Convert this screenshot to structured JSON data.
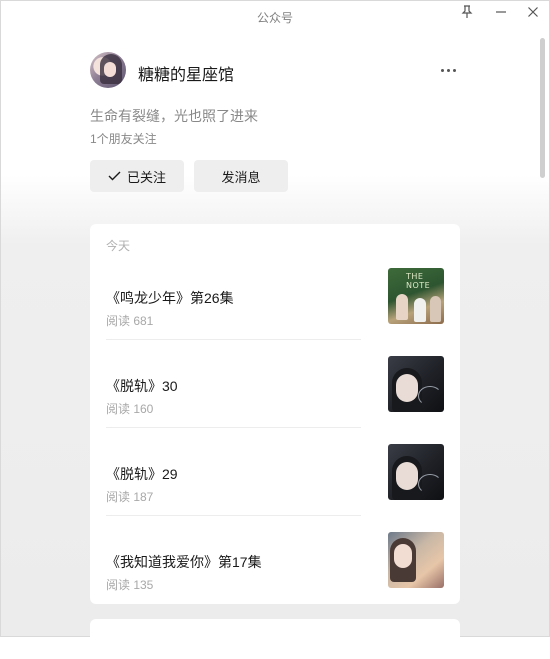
{
  "window": {
    "title": "公众号",
    "controls": {
      "pin_icon": "pin-icon",
      "minimize_icon": "minimize-icon",
      "close_icon": "close-icon"
    }
  },
  "account": {
    "name": "糖糖的星座馆",
    "bio": "生命有裂缝，光也照了进来",
    "followers_text": "1个朋友关注",
    "avatar_icon": "avatar",
    "more_icon": "more-dots-icon"
  },
  "actions": {
    "followed_label": "已关注",
    "followed_icon": "checkmark-icon",
    "message_label": "发消息"
  },
  "feed": {
    "section_label": "今天",
    "articles": [
      {
        "title": "《鸣龙少年》第26集",
        "reads": "阅读 681"
      },
      {
        "title": "《脱轨》30",
        "reads": "阅读 160"
      },
      {
        "title": "《脱轨》29",
        "reads": "阅读 187"
      },
      {
        "title": "《我知道我爱你》第17集",
        "reads": "阅读 135"
      }
    ]
  },
  "colors": {
    "accent_text": "#1a1a1a",
    "muted_text": "#888888",
    "button_bg": "#eeeeee",
    "card_bg": "#ffffff",
    "page_bg": "#ececec"
  }
}
